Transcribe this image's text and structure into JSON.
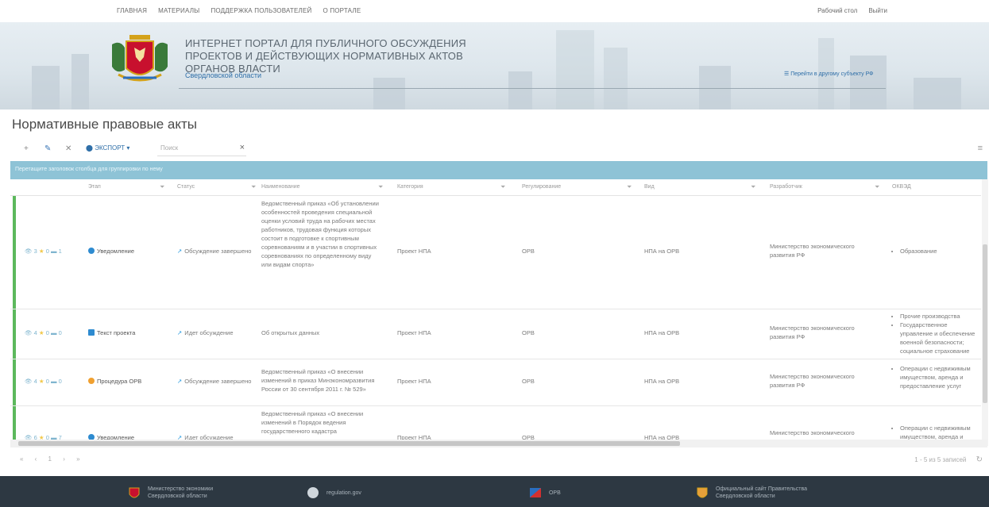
{
  "topnav": {
    "links": [
      "ГЛАВНАЯ",
      "МАТЕРИАЛЫ",
      "ПОДДЕРЖКА ПОЛЬЗОВАТЕЛЕЙ",
      "О ПОРТАЛЕ"
    ],
    "desktop": "Рабочий стол",
    "logout": "Выйти"
  },
  "banner": {
    "title": "ИНТЕРНЕТ ПОРТАЛ ДЛЯ ПУБЛИЧНОГО ОБСУЖДЕНИЯ ПРОЕКТОВ И ДЕЙСТВУЮЩИХ НОРМАТИВНЫХ АКТОВ ОРГАНОВ ВЛАСТИ",
    "region": "Свердловской области",
    "other_subject": "☰ Перейти в другому субъекту РФ"
  },
  "page_title": "Нормативные правовые акты",
  "toolbar": {
    "export": "ЭКСПОРТ",
    "search_placeholder": "Поиск"
  },
  "groupbar": "Перетащите заголовок столбца для группировки по нему",
  "columns": [
    "Этап",
    "Статус",
    "Наименование",
    "Категория",
    "Регулирование",
    "Вид",
    "Разработчик",
    "ОКВЭД"
  ],
  "rows": [
    {
      "views": "3",
      "stars": "0",
      "comments": "1",
      "stage": "Уведомление",
      "stage_color": "#2e8bd0",
      "status": "Обсуждение завершено",
      "name": "Ведомственный приказ «Об установлении особенностей проведения специальной оценки условий труда на рабочих местах работников, трудовая функция которых состоит в подготовке к спортивным соревнованиям и в участии в спортивных соревнованиях по определенному виду или видам спорта»",
      "category": "Проект НПА",
      "regulation": "ОРВ",
      "kind": "НПА на ОРВ",
      "developer": "Министерство экономического развития РФ",
      "okved": [
        "Образование"
      ]
    },
    {
      "views": "4",
      "stars": "0",
      "comments": "0",
      "stage": "Текст проекта",
      "stage_color": "#2e8bd0",
      "status": "Идет обсуждение",
      "name": "Об открытых данных",
      "category": "Проект НПА",
      "regulation": "ОРВ",
      "kind": "НПА на ОРВ",
      "developer": "Министерство экономического развития РФ",
      "okved": [
        "Прочие производства",
        "Государственное управление и обеспечение военной безопасности; социальное страхование"
      ]
    },
    {
      "views": "4",
      "stars": "0",
      "comments": "0",
      "stage": "Процедура ОРВ",
      "stage_color": "#f0a030",
      "status": "Обсуждение завершено",
      "name": "Ведомственный приказ «О внесении изменений в приказ Минэкономразвития России от 30 сентября 2011 г. № 529»",
      "category": "Проект НПА",
      "regulation": "ОРВ",
      "kind": "НПА на ОРВ",
      "developer": "Министерство экономического развития РФ",
      "okved": [
        "Операции с недвижимым имуществом, аренда и предоставление услуг"
      ]
    },
    {
      "views": "6",
      "stars": "0",
      "comments": "7",
      "stage": "Уведомление",
      "stage_color": "#2e8bd0",
      "status": "Идет обсуждение",
      "name": "Ведомственный приказ «О внесении изменений в Порядок ведения государственного кадастра",
      "category": "Проект НПА",
      "regulation": "ОРВ",
      "kind": "НПА на ОРВ",
      "developer": "Министерство экономического развития РФ",
      "okved": [
        "Операции с недвижимым имуществом, аренда и"
      ]
    }
  ],
  "pager": {
    "nav": "« ‹ 1 › »",
    "summary": "1 - 5 из 5 записей"
  },
  "footer": {
    "item1": "Министерство экономики Свердловской области",
    "item2": "regulation.gov",
    "item3": "ОРВ",
    "item4": "Официальный сайт Правительства Свердловской области"
  }
}
